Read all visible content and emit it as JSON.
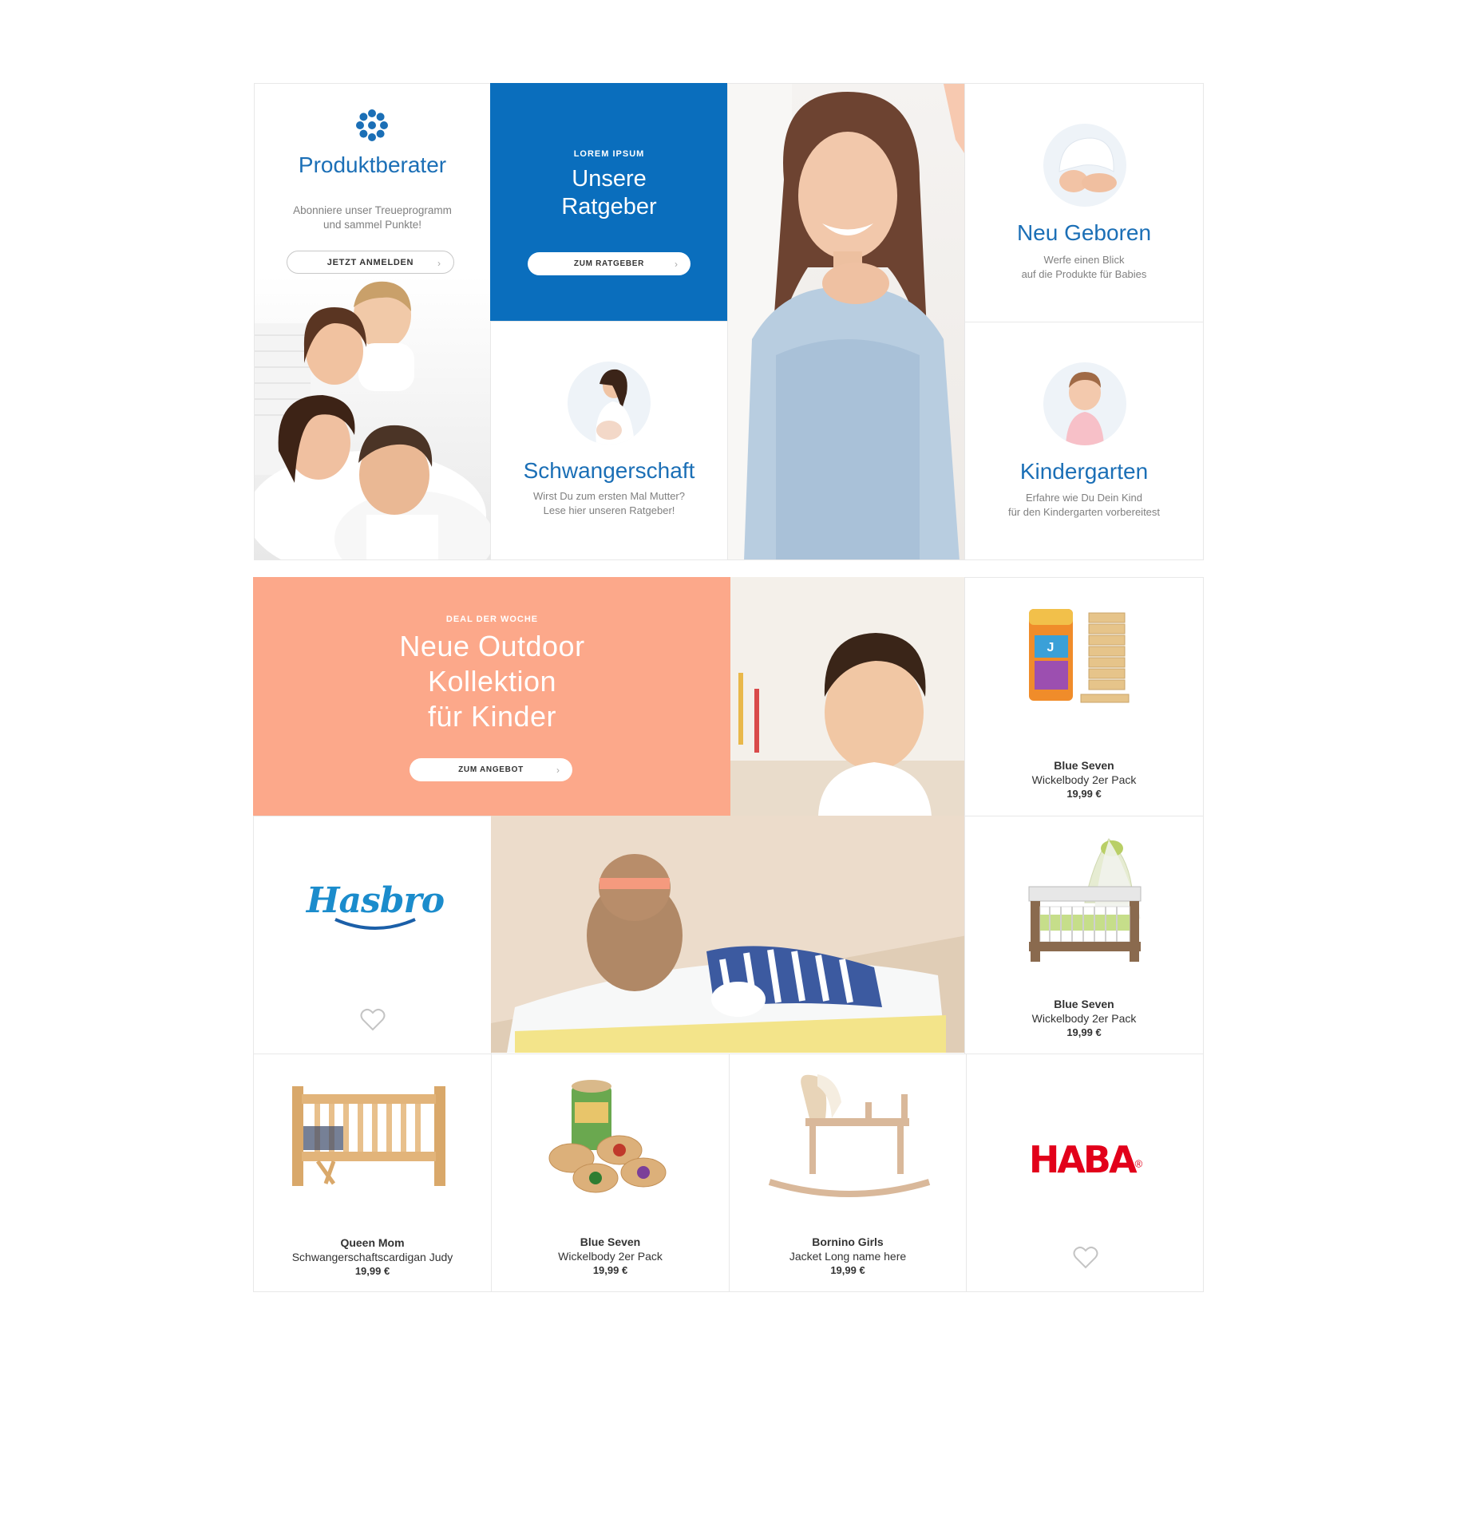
{
  "row1": {
    "produktberater": {
      "title": "Produktberater",
      "desc_line1": "Abonniere unser Treueprogramm",
      "desc_line2": "und sammel Punkte!",
      "button": "JETZT ANMELDEN"
    },
    "ratgeber": {
      "eyebrow": "LOREM IPSUM",
      "title_line1": "Unsere",
      "title_line2": "Ratgeber",
      "button": "ZUM RATGEBER"
    },
    "schwangerschaft": {
      "title": "Schwangerschaft",
      "desc_line1": "Wirst Du zum ersten  Mal Mutter?",
      "desc_line2": "Lese hier unseren Ratgeber!"
    },
    "neugeboren": {
      "title": "Neu Geboren",
      "desc_line1": "Werfe einen Blick",
      "desc_line2": "auf die Produkte für Babies"
    },
    "kindergarten": {
      "title": "Kindergarten",
      "desc_line1": "Erfahre wie Du Dein Kind",
      "desc_line2": "für den Kindergarten vorbereitest"
    }
  },
  "deal": {
    "eyebrow": "DEAL DER WOCHE",
    "title_line1": "Neue Outdoor",
    "title_line2": "Kollektion",
    "title_line3": "für Kinder",
    "button": "ZUM ANGEBOT"
  },
  "brands": {
    "hasbro": "Hasbro",
    "haba": "HABA",
    "haba_reg": "®"
  },
  "products": [
    {
      "brand": "Blue Seven",
      "name": "Wickelbody 2er Pack",
      "price": "19,99 €"
    },
    {
      "brand": "Blue Seven",
      "name": "Wickelbody 2er Pack",
      "price": "19,99 €"
    },
    {
      "brand": "Queen Mom",
      "name": "Schwangerschaftscardigan Judy",
      "price": "19,99 €"
    },
    {
      "brand": "Blue Seven",
      "name": "Wickelbody 2er Pack",
      "price": "19,99 €"
    },
    {
      "brand": "Bornino Girls",
      "name": "Jacket Long name here",
      "price": "19,99 €"
    }
  ],
  "colors": {
    "accent_blue": "#1b6fb6",
    "ratgeber_bg": "#0a6ebd",
    "deal_bg": "#fca88a",
    "haba_red": "#e2001a"
  }
}
